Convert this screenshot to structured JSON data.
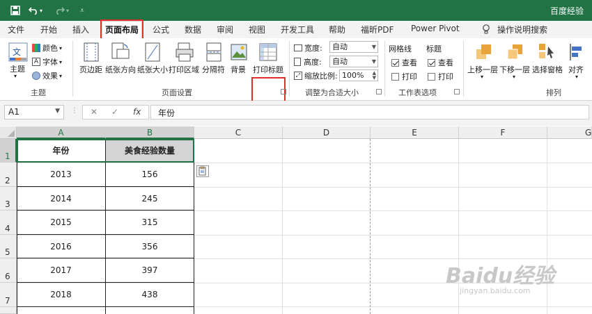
{
  "titlebar": {
    "save_icon": "save-icon",
    "undo_icon": "undo-icon",
    "redo_icon": "redo-icon",
    "title": "百度经验",
    "color": "#217346"
  },
  "tabs": [
    {
      "label": "文件"
    },
    {
      "label": "开始"
    },
    {
      "label": "插入"
    },
    {
      "label": "页面布局",
      "active": true
    },
    {
      "label": "公式"
    },
    {
      "label": "数据"
    },
    {
      "label": "审阅"
    },
    {
      "label": "视图"
    },
    {
      "label": "开发工具"
    },
    {
      "label": "帮助"
    },
    {
      "label": "福昕PDF"
    },
    {
      "label": "Power Pivot"
    }
  ],
  "tell_me": "操作说明搜索",
  "ribbon": {
    "themes": {
      "themes_label": "主题",
      "colors_label": "颜色",
      "fonts_label": "字体",
      "effects_label": "效果",
      "group_label": "主题"
    },
    "page_setup": {
      "margins": "页边距",
      "orientation": "纸张方向",
      "size": "纸张大小",
      "print_area": "打印区域",
      "breaks": "分隔符",
      "background": "背景",
      "print_titles": "打印标题",
      "group_label": "页面设置"
    },
    "scale": {
      "width_label": "宽度:",
      "width_value": "自动",
      "height_label": "高度:",
      "height_value": "自动",
      "scale_label": "缩放比例:",
      "scale_value": "100%",
      "group_label": "调整为合适大小"
    },
    "sheet_options": {
      "gridlines": "网格线",
      "headings": "标题",
      "view": "查看",
      "print": "打印",
      "group_label": "工作表选项"
    },
    "arrange": {
      "bring_forward": "上移一层",
      "send_backward": "下移一层",
      "selection_pane": "选择窗格",
      "align": "对齐",
      "group_label": "排列"
    }
  },
  "formula_bar": {
    "name_box": "A1",
    "cancel": "✕",
    "enter": "✓",
    "fx": "fx",
    "formula": "年份"
  },
  "columns": [
    "A",
    "B",
    "C",
    "D",
    "E",
    "F",
    "G"
  ],
  "rows": [
    "1",
    "2",
    "3",
    "4",
    "5",
    "6",
    "7"
  ],
  "table": {
    "headers": [
      "年份",
      "美食经验数量"
    ],
    "data": [
      [
        "2013",
        "156"
      ],
      [
        "2014",
        "245"
      ],
      [
        "2015",
        "315"
      ],
      [
        "2016",
        "356"
      ],
      [
        "2017",
        "397"
      ],
      [
        "2018",
        "438"
      ]
    ]
  },
  "watermark": {
    "main": "Baidu经验",
    "sub": "jingyan.baidu.com"
  }
}
